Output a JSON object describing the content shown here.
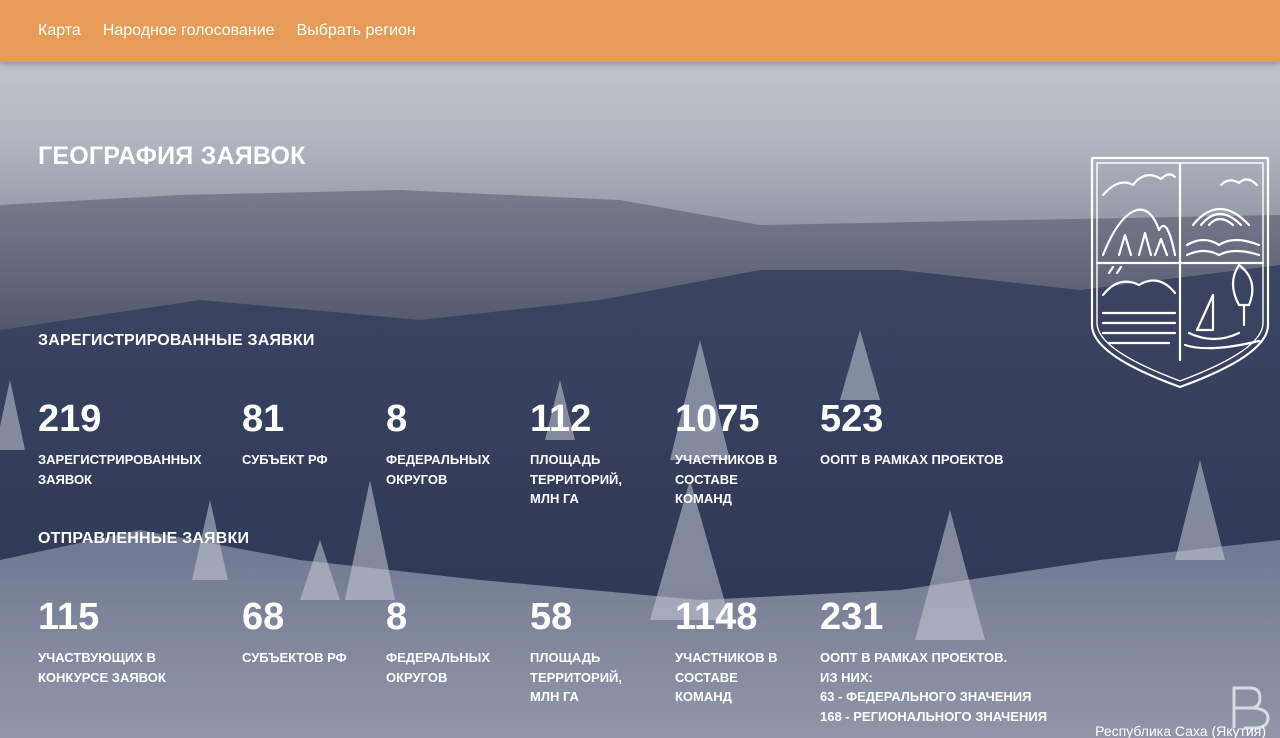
{
  "nav": {
    "items": [
      {
        "label": "Карта"
      },
      {
        "label": "Народное голосование"
      },
      {
        "label": "Выбрать регион"
      }
    ]
  },
  "page": {
    "title": "ГЕОГРАФИЯ ЗАЯВОК",
    "region": "Республика Саха (Якутия)"
  },
  "registered": {
    "title": "ЗАРЕГИСТРИРОВАННЫЕ ЗАЯВКИ",
    "stats": [
      {
        "value": "219",
        "label": "ЗАРЕГИСТРИРОВАННЫХ\nЗАЯВОК"
      },
      {
        "value": "81",
        "label": "СУБЪЕКТ РФ"
      },
      {
        "value": "8",
        "label": "ФЕДЕРАЛЬНЫХ\nОКРУГОВ"
      },
      {
        "value": "112",
        "label": "ПЛОЩАДЬ\nТЕРРИТОРИЙ,\nМЛН ГА"
      },
      {
        "value": "1075",
        "label": "УЧАСТНИКОВ В\nСОСТАВЕ\nКОМАНД"
      },
      {
        "value": "523",
        "label": "ООПТ В РАМКАХ ПРОЕКТОВ"
      }
    ]
  },
  "sent": {
    "title": "ОТПРАВЛЕННЫЕ ЗАЯВКИ",
    "stats": [
      {
        "value": "115",
        "label": "УЧАСТВУЮЩИХ В\nКОНКУРСЕ ЗАЯВОК"
      },
      {
        "value": "68",
        "label": "СУБЪЕКТОВ РФ"
      },
      {
        "value": "8",
        "label": "ФЕДЕРАЛЬНЫХ\nОКРУГОВ"
      },
      {
        "value": "58",
        "label": "ПЛОЩАДЬ\nТЕРРИТОРИЙ,\nМЛН ГА"
      },
      {
        "value": "1148",
        "label": "УЧАСТНИКОВ В\nСОСТАВЕ\nКОМАНД"
      },
      {
        "value": "231",
        "label": "ООПТ В РАМКАХ ПРОЕКТОВ.\nИЗ НИХ:\n63 - ФЕДЕРАЛЬНОГО ЗНАЧЕНИЯ\n168 - РЕГИОНАЛЬНОГО ЗНАЧЕНИЯ"
      }
    ]
  },
  "colors": {
    "topbar": "#e69c56",
    "text": "#ffffff"
  },
  "icons": {
    "emblem": "coat-of-arms-icon",
    "logo": "rg-logo-icon"
  }
}
